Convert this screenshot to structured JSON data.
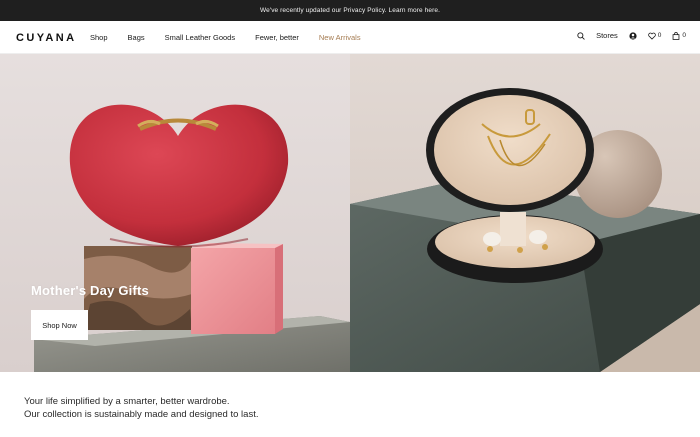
{
  "announcement": "We've recently updated our Privacy Policy. Learn more here.",
  "brand": {
    "logo_text": "CUYANA"
  },
  "nav": {
    "items": [
      {
        "label": "Shop"
      },
      {
        "label": "Bags"
      },
      {
        "label": "Small Leather Goods"
      },
      {
        "label": "Fewer, better"
      },
      {
        "label": "New Arrivals"
      }
    ],
    "accent_color": "#a57c52"
  },
  "utility": {
    "stores_label": "Stores",
    "wishlist_count": "0",
    "cart_count": "0",
    "icons": [
      "search-icon",
      "account-icon",
      "heart-icon",
      "bag-icon"
    ]
  },
  "hero": {
    "title": "Mother's Day Gifts",
    "cta_label": "Shop Now"
  },
  "tagline": {
    "line1": "Your life simplified by a smarter, better wardrobe.",
    "line2": "Our collection is sustainably made and designed to last."
  },
  "colors": {
    "announcement_bg": "#1f1f1f",
    "heart_bag_red": "#c8323f",
    "left_bg": "#e4dcdb",
    "right_bg": "#ddd3cc"
  }
}
